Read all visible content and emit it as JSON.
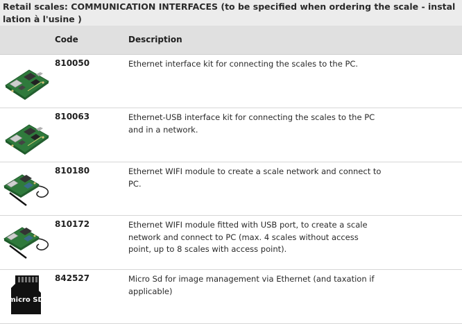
{
  "caption": "Retail scales: COMMUNICATION INTERFACES (to be specified when ordering the scale - installation à l'usine )",
  "table": {
    "headers": {
      "code": "Code",
      "description": "Description"
    },
    "rows": [
      {
        "image": "ethernet-board-image",
        "code": "810050",
        "description": "Ethernet interface kit for connecting the scales to the PC."
      },
      {
        "image": "ethernet-board-image",
        "code": "810063",
        "description": "Ethernet-USB interface kit for connecting the scales to the PC and in a network."
      },
      {
        "image": "wifi-module-image",
        "code": "810180",
        "description": "Ethernet WIFI module to create a scale network and connect to PC."
      },
      {
        "image": "wifi-module-image",
        "code": "810172",
        "description": "Ethernet WIFI module fitted with USB port, to create a scale network and connect to PC (max. 4 scales without access point, up to 8 scales with access point)."
      },
      {
        "image": "micro-sd-card-image",
        "code": "842527",
        "description": "Micro Sd for image management via Ethernet (and taxation if applicable)"
      }
    ]
  },
  "icons": {
    "sd_logo_text": "micro SD"
  },
  "colors": {
    "pcb_green": "#3f8a4a",
    "header_gray": "#e0e0e0",
    "caption_gray": "#ececec"
  }
}
